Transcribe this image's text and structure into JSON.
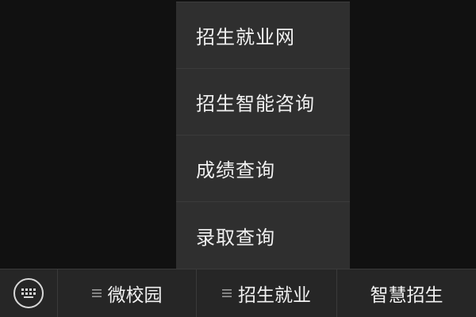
{
  "popup_menu": {
    "items": [
      {
        "label": "招生就业网"
      },
      {
        "label": "招生智能咨询"
      },
      {
        "label": "成绩查询"
      },
      {
        "label": "录取查询"
      }
    ]
  },
  "bottom_bar": {
    "keyboard_icon": "keyboard-icon",
    "tabs": [
      {
        "label": "微校园",
        "icon": "menu-list-icon"
      },
      {
        "label": "招生就业",
        "icon": "menu-list-icon"
      },
      {
        "label": "智慧招生"
      }
    ]
  },
  "colors": {
    "background": "#111111",
    "menu_background": "#2f2f2f",
    "bar_background": "#262626",
    "text": "#f0f0f0"
  }
}
